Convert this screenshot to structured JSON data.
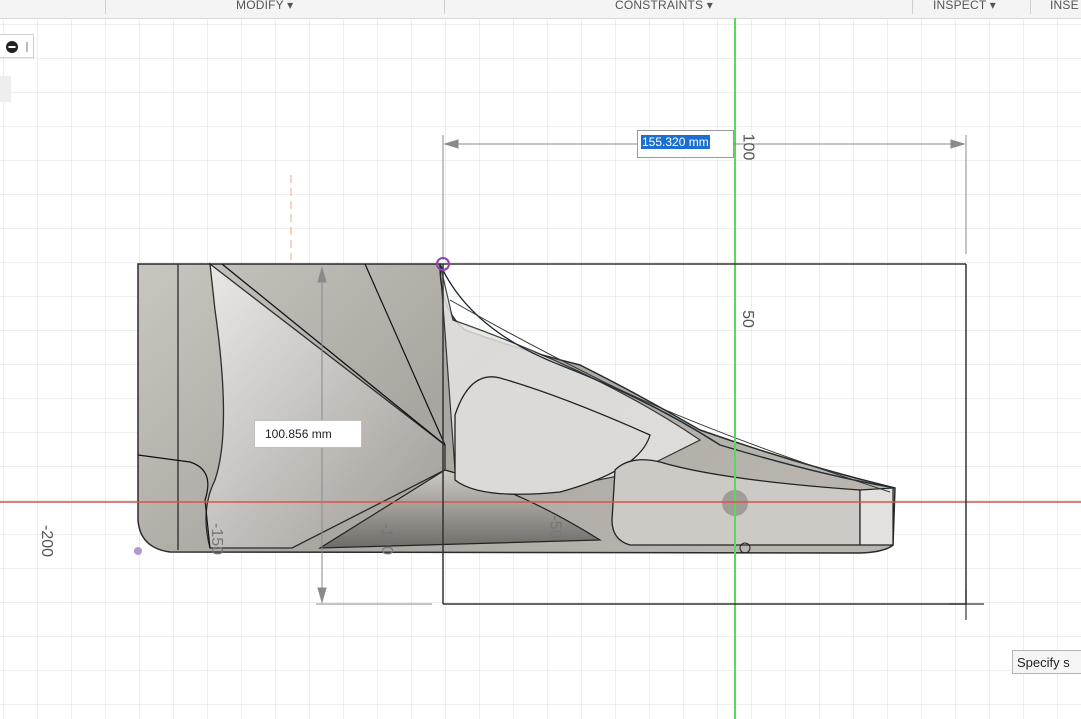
{
  "toolbar": {
    "modify_label": "MODIFY ▾",
    "constraints_label": "CONSTRAINTS ▾",
    "inspect_label": "INSPECT ▾",
    "insert_label": "INSE"
  },
  "sketch": {
    "width_dimension": "155.320 mm",
    "height_dimension": "100.856 mm"
  },
  "axis_labels": {
    "top_100": "100",
    "vertical_50": "50",
    "neg_200": "-200",
    "neg_150": "-150",
    "neg_100": "-100",
    "neg_50": "-50"
  },
  "status_tip": "Specify s",
  "colors": {
    "x_axis": "#d9534f",
    "y_axis": "#5cd65c",
    "grid": "#dcdcdc",
    "selection": "#1b6fd0",
    "sketch_point": "#8e44ad"
  }
}
